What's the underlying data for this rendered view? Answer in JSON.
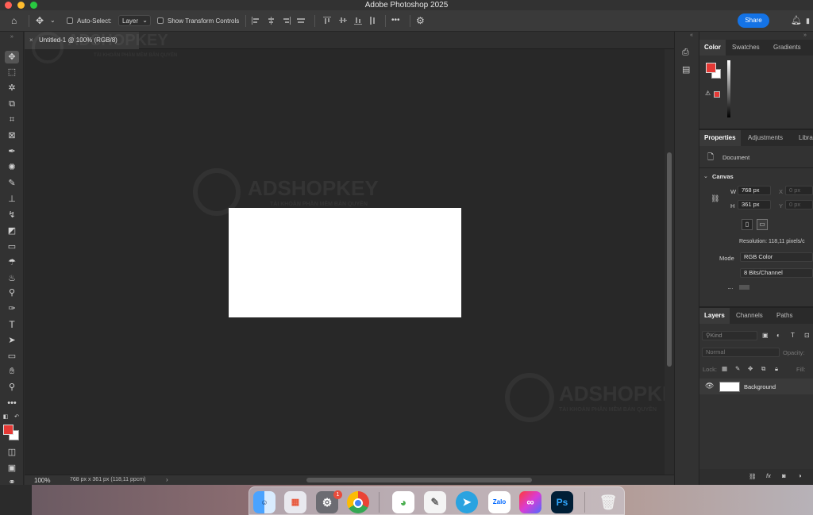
{
  "window": {
    "title": "Adobe Photoshop 2025"
  },
  "options_bar": {
    "auto_select_label": "Auto-Select:",
    "auto_select_target": "Layer",
    "show_transform_label": "Show Transform Controls",
    "more_label": "•••",
    "share_label": "Share"
  },
  "document": {
    "tab_title": "Untitled-1 @ 100% (RGB/8)",
    "zoom": "100%",
    "size_info": "768 px x 361 px (118,11 ppcm)"
  },
  "watermark": {
    "brand": "ADSHOPKEY",
    "tagline": "TÀI KHOẢN PHẦN MỀM BẢN QUYỀN"
  },
  "color_panel": {
    "tabs": [
      "Color",
      "Swatches",
      "Gradients"
    ],
    "foreground": "#e53935",
    "background": "#ffffff"
  },
  "properties_panel": {
    "tabs": [
      "Properties",
      "Adjustments",
      "Libra"
    ],
    "document_label": "Document",
    "canvas_heading": "Canvas",
    "w_label": "W",
    "w_value": "768 px",
    "h_label": "H",
    "h_value": "361 px",
    "x_label": "X",
    "x_value": "0 px",
    "y_label": "Y",
    "y_value": "0 px",
    "resolution": "Resolution: 118,11 pixels/c",
    "mode_label": "Mode",
    "mode_value": "RGB Color",
    "bits_value": "8 Bits/Channel"
  },
  "layers_panel": {
    "tabs": [
      "Layers",
      "Channels",
      "Paths"
    ],
    "filter_placeholder": "Kind",
    "blend_mode": "Normal",
    "opacity_label": "Opacity:",
    "lock_label": "Lock:",
    "fill_label": "Fill:",
    "layers": [
      {
        "name": "Background"
      }
    ]
  },
  "dock": {
    "notification_badge": "1",
    "zalo_label": "Zalo",
    "ps_label": "Ps"
  },
  "colors": {
    "accent": "#1473e6",
    "foreground_swatch": "#e53935"
  }
}
